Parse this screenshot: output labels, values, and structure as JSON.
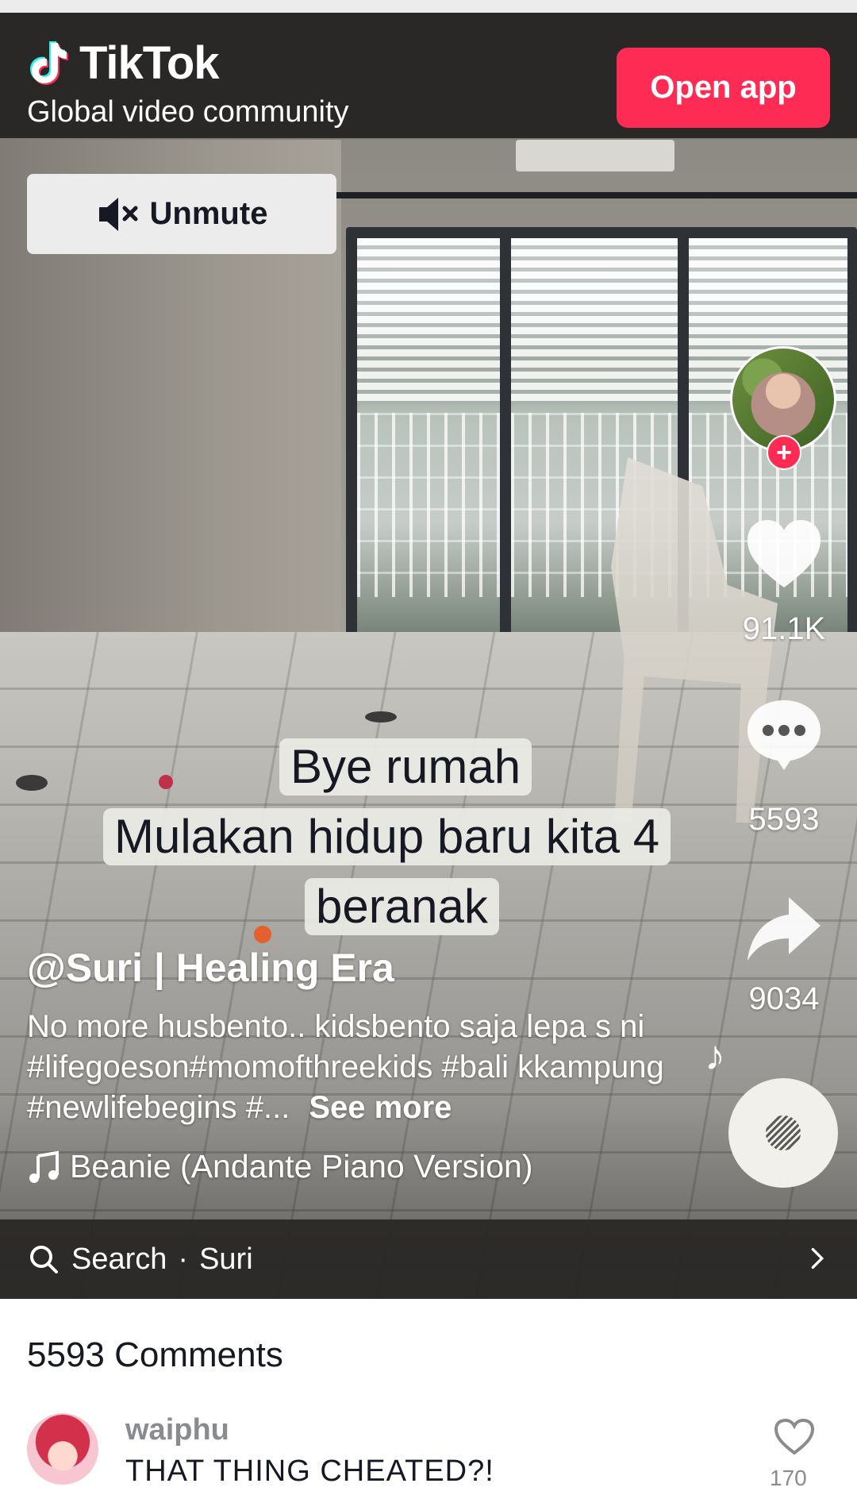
{
  "header": {
    "brand_name": "TikTok",
    "subtitle": "Global video community",
    "open_app_label": "Open app",
    "accent_color": "#fe2c55"
  },
  "video": {
    "unmute_label": "Unmute",
    "caption_lines": [
      "Bye rumah",
      "Mulakan hidup baru kita 4",
      "beranak"
    ],
    "author": "@Suri | Healing Era",
    "description": "No more husbento.. kidsbento saja lepa s ni  #lifegoeson#momofthreekids #bali kkampung #newlifebegins #...",
    "see_more_label": "See more",
    "music_title": "Beanie (Andante Piano Version)"
  },
  "rail": {
    "likes": "91.1K",
    "comments": "5593",
    "shares": "9034",
    "follow_icon": "plus-icon",
    "music_note_icon": "music-note-icon"
  },
  "search": {
    "label": "Search",
    "separator": "·",
    "query": "Suri"
  },
  "comments": {
    "title": "5593 Comments",
    "items": [
      {
        "username": "waiphu",
        "text": "THAT THING CHEATED?!",
        "likes": "170"
      }
    ]
  }
}
